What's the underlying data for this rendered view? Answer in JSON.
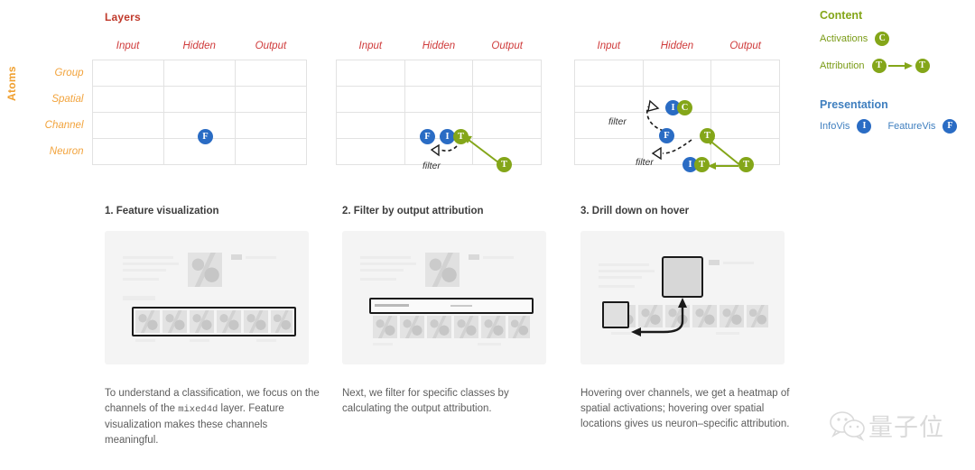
{
  "matrices": {
    "title": "Layers",
    "axis_label_vertical": "Atoms",
    "columns": [
      "Input",
      "Hidden",
      "Output"
    ],
    "rows": [
      "Group",
      "Spatial",
      "Channel",
      "Neuron"
    ],
    "filter_label": "filter",
    "diagram_1": {
      "badges": [
        {
          "letter": "F",
          "color": "blue",
          "row": "Channel",
          "col": "Hidden"
        }
      ]
    },
    "diagram_2": {
      "badges": [
        {
          "letter": "F",
          "color": "blue",
          "row": "Channel",
          "col": "Hidden"
        },
        {
          "letter": "I",
          "color": "blue",
          "row": "Channel",
          "col": "Hidden"
        },
        {
          "letter": "T",
          "color": "green",
          "row": "Channel",
          "col": "Hidden"
        },
        {
          "letter": "T",
          "color": "green",
          "row": "Neuron",
          "col": "Output"
        }
      ],
      "filter_labels": [
        "filter"
      ]
    },
    "diagram_3": {
      "badges": [
        {
          "letter": "I",
          "color": "blue",
          "row": "Spatial",
          "col": "Hidden"
        },
        {
          "letter": "C",
          "color": "green",
          "row": "Spatial",
          "col": "Hidden"
        },
        {
          "letter": "F",
          "color": "blue",
          "row": "Channel",
          "col": "Hidden"
        },
        {
          "letter": "T",
          "color": "green",
          "row": "Channel",
          "col": "Output"
        },
        {
          "letter": "I",
          "color": "blue",
          "row": "Neuron",
          "col": "Hidden"
        },
        {
          "letter": "T",
          "color": "green",
          "row": "Neuron",
          "col": "Hidden"
        },
        {
          "letter": "T",
          "color": "green",
          "row": "Neuron",
          "col": "Output"
        }
      ],
      "filter_labels": [
        "filter",
        "filter"
      ]
    }
  },
  "legend": {
    "content": {
      "heading": "Content",
      "items": [
        {
          "label": "Activations",
          "badge": "C",
          "color": "green"
        },
        {
          "label": "Attribution",
          "badge": "T",
          "badge2": "T",
          "color": "green",
          "arrow": true
        }
      ]
    },
    "presentation": {
      "heading": "Presentation",
      "items": [
        {
          "label": "InfoVis",
          "badge": "I",
          "color": "blue"
        },
        {
          "label": "FeatureVis",
          "badge": "F",
          "color": "blue"
        }
      ]
    }
  },
  "panels": [
    {
      "title": "1. Feature visualization",
      "caption_part1": "To understand a classification, we focus on the channels of the ",
      "caption_code": "mixed4d",
      "caption_part2": " layer. Feature visualization makes these channels meaningful."
    },
    {
      "title": "2. Filter by output attribution",
      "caption_part1": "Next, we filter for specific classes by calculating the output attribution.",
      "caption_code": "",
      "caption_part2": ""
    },
    {
      "title": "3. Drill down on hover",
      "caption_part1": "Hovering over channels, we get a heatmap of spatial activations; hovering over spatial locations gives us neuron–specific attribution.",
      "caption_code": "",
      "caption_part2": ""
    }
  ],
  "watermark": {
    "text": "量子位",
    "icon": "wechat-icon"
  },
  "colors": {
    "blue_badge": "#2a6cc4",
    "green_badge": "#84a619",
    "column_header": "#cf3b3b",
    "row_header": "#f2a33c",
    "title_red": "#c0392b",
    "content_green": "#84a619",
    "presentation_blue": "#3f7fbf"
  }
}
